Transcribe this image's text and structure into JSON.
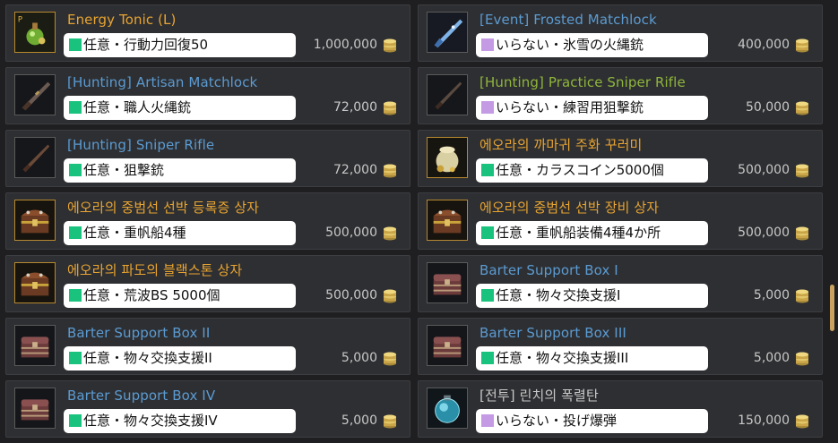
{
  "colors": {
    "gold_name": "#e8a431",
    "blue_name": "#5b9bd2",
    "green_name": "#8fb63c",
    "gray_name": "#c8c8c8",
    "status_optional": "#19c37d",
    "status_unneeded": "#c49ae4"
  },
  "items": [
    {
      "name": "Energy Tonic (L)",
      "name_color": "gold",
      "note": "任意・行動力回復50",
      "status": "optional",
      "price": "1,000,000",
      "icon": "energy-tonic-icon"
    },
    {
      "name": "[Event] Frosted Matchlock",
      "name_color": "blue",
      "note": "いらない・氷雪の火縄銃",
      "status": "unneeded",
      "price": "400,000",
      "icon": "frosted-matchlock-icon"
    },
    {
      "name": "[Hunting] Artisan Matchlock",
      "name_color": "blue",
      "note": "任意・職人火縄銃",
      "status": "optional",
      "price": "72,000",
      "icon": "artisan-matchlock-icon"
    },
    {
      "name": "[Hunting] Practice Sniper Rifle",
      "name_color": "green",
      "note": "いらない・練習用狙撃銃",
      "status": "unneeded",
      "price": "50,000",
      "icon": "practice-sniper-rifle-icon"
    },
    {
      "name": "[Hunting] Sniper Rifle",
      "name_color": "blue",
      "note": "任意・狙撃銃",
      "status": "optional",
      "price": "72,000",
      "icon": "sniper-rifle-icon"
    },
    {
      "name": "에오라의 까마귀 주화 꾸러미",
      "name_color": "gold",
      "note": "任意・カラスコイン5000個",
      "status": "optional",
      "price": "500,000",
      "icon": "crow-coin-pouch-icon"
    },
    {
      "name": "에오라의 중범선 선박 등록증 상자",
      "name_color": "gold",
      "note": "任意・重帆船4種",
      "status": "optional",
      "price": "500,000",
      "icon": "treasure-chest-icon"
    },
    {
      "name": "에오라의 중범선 선박 장비 상자",
      "name_color": "gold",
      "note": "任意・重帆船装備4種4か所",
      "status": "optional",
      "price": "500,000",
      "icon": "treasure-chest-icon"
    },
    {
      "name": "에오라의 파도의 블랙스톤 상자",
      "name_color": "gold",
      "note": "任意・荒波BS 5000個",
      "status": "optional",
      "price": "500,000",
      "icon": "treasure-chest-icon"
    },
    {
      "name": "Barter Support Box I",
      "name_color": "blue",
      "note": "任意・物々交換支援I",
      "status": "optional",
      "price": "5,000",
      "icon": "barter-box-icon"
    },
    {
      "name": "Barter Support Box II",
      "name_color": "blue",
      "note": "任意・物々交換支援II",
      "status": "optional",
      "price": "5,000",
      "icon": "barter-box-icon"
    },
    {
      "name": "Barter Support Box III",
      "name_color": "blue",
      "note": "任意・物々交換支援III",
      "status": "optional",
      "price": "5,000",
      "icon": "barter-box-icon"
    },
    {
      "name": "Barter Support Box IV",
      "name_color": "blue",
      "note": "任意・物々交換支援IV",
      "status": "optional",
      "price": "5,000",
      "icon": "barter-box-icon"
    },
    {
      "name": "[전투] 린치의 폭렬탄",
      "name_color": "gray",
      "note": "いらない・投げ爆弾",
      "status": "unneeded",
      "price": "150,000",
      "icon": "blast-bomb-icon"
    }
  ]
}
